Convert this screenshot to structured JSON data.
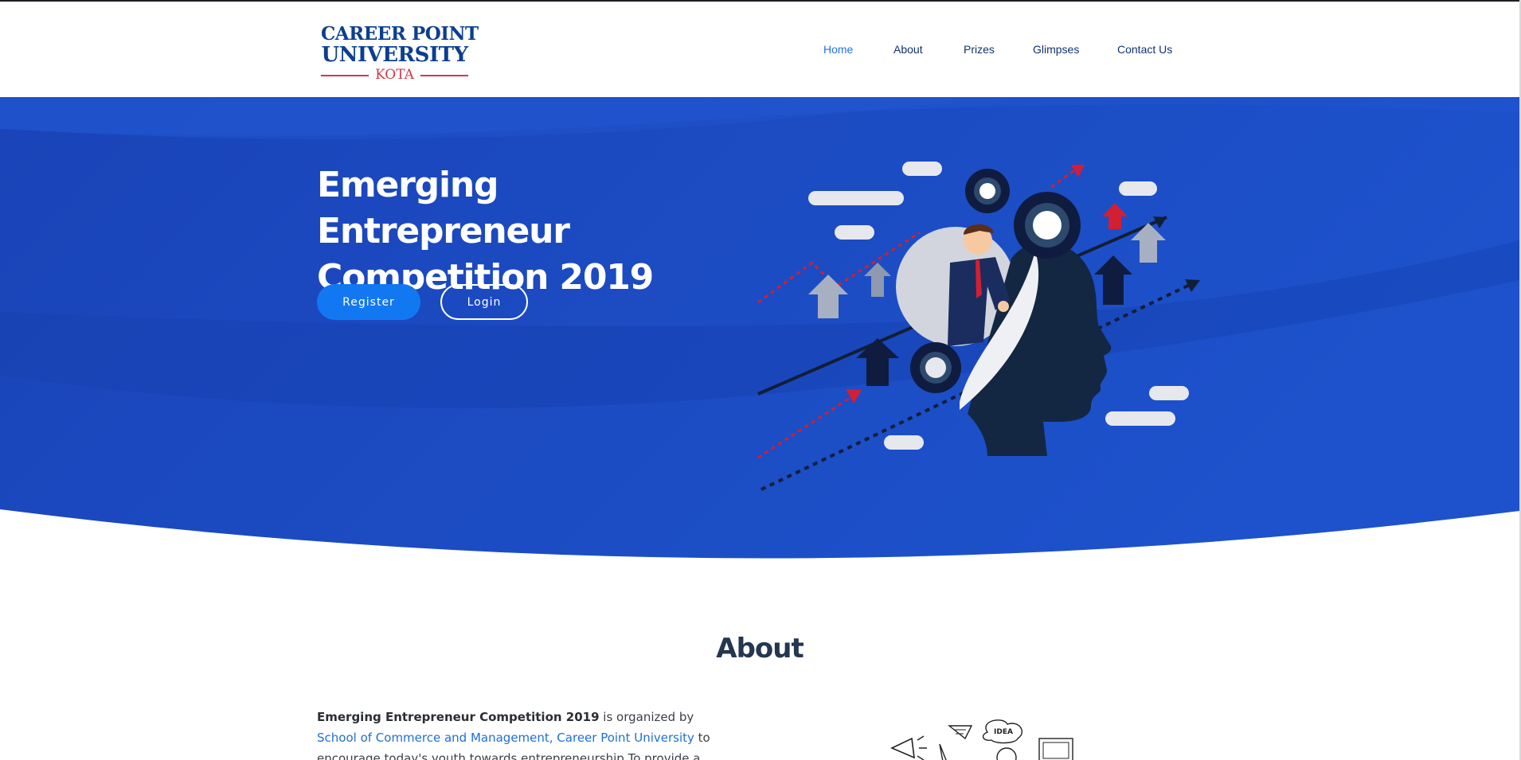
{
  "logo": {
    "line1": "CAREER POINT",
    "line2": "UNIVERSITY",
    "line3": "KOTA"
  },
  "nav": {
    "items": [
      {
        "label": "Home",
        "active": true
      },
      {
        "label": "About",
        "active": false
      },
      {
        "label": "Prizes",
        "active": false
      },
      {
        "label": "Glimpses",
        "active": false
      },
      {
        "label": "Contact Us",
        "active": false
      }
    ]
  },
  "hero": {
    "title_line1": "Emerging Entrepreneur",
    "title_line2": "Competition 2019",
    "register_label": "Register",
    "login_label": "Login"
  },
  "about": {
    "heading": "About",
    "p_strong": "Emerging Entrepreneur Competition 2019",
    "p_text1": " is organized by ",
    "p_link": "School of Commerce and Management, Career Point University",
    "p_text2": " to encourage today's youth towards entrepreneurship.To provide a platform to the"
  },
  "colors": {
    "brand_blue": "#0c3f8f",
    "hero_blue": "#1a47c0",
    "accent_blue": "#1278f2",
    "brand_red": "#d2374a"
  },
  "icons": {
    "illustration": "entrepreneur-head-gears-illustration",
    "doodle": "business-doodle-idea-illustration"
  }
}
